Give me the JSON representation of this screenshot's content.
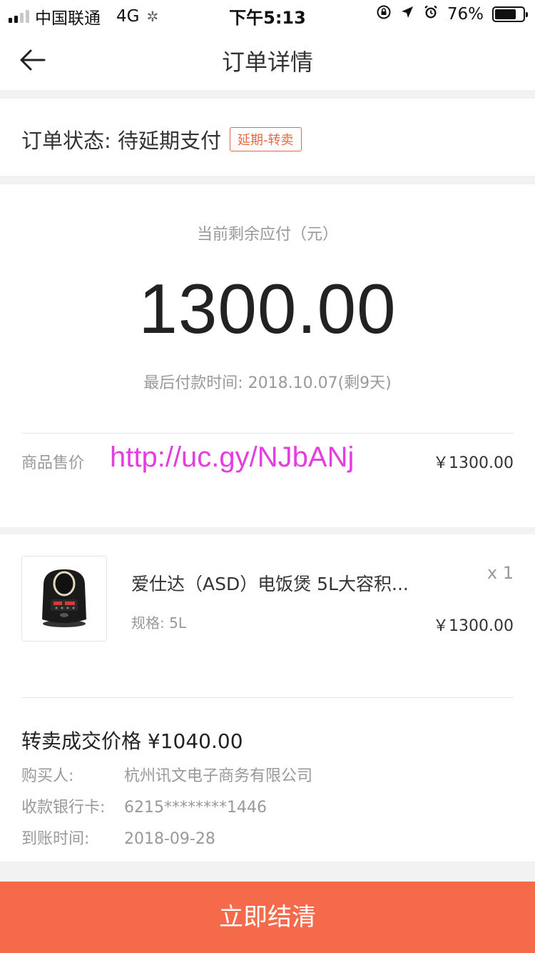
{
  "status_bar": {
    "carrier": "中国联通",
    "network": "4G",
    "time": "下午5:13",
    "battery": "76%",
    "battery_level": 0.76
  },
  "header": {
    "title": "订单详情"
  },
  "order_status": {
    "text": "订单状态: 待延期支付",
    "tag": "延期-转卖"
  },
  "amount": {
    "label": "当前剩余应付（元）",
    "value": "1300.00",
    "deadline": "最后付款时间: 2018.10.07(剩9天)"
  },
  "price_row": {
    "label": "商品售价",
    "watermark": "http://uc.gy/NJbANj",
    "value": "￥1300.00"
  },
  "goods": {
    "name": "爱仕达（ASD）电饭煲 5L大容积...",
    "quantity": "x 1",
    "spec": "规格: 5L",
    "price": "￥1300.00"
  },
  "resale": {
    "title": "转卖成交价格  ¥1040.00",
    "buyer_label": "购买人:",
    "buyer_value": "杭州讯文电子商务有限公司",
    "card_label": "收款银行卡:",
    "card_value": "6215********1446",
    "date_label": "到账时间:",
    "date_value": "2018-09-28"
  },
  "footer": {
    "button": "立即结清"
  },
  "colors": {
    "accent": "#f56a4b",
    "tag": "#e8693f",
    "watermark": "#e43ee0"
  }
}
